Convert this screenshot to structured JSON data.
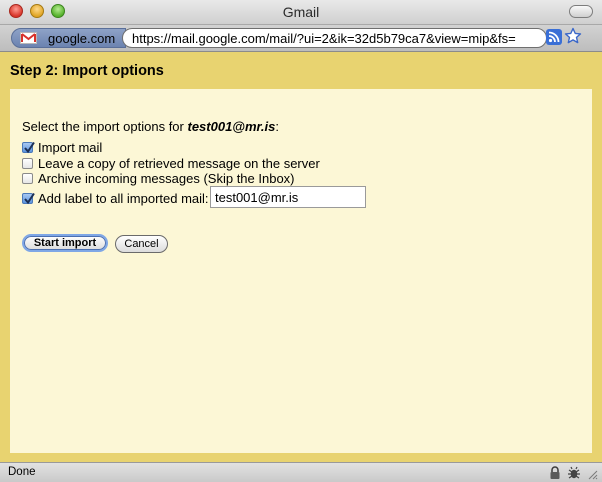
{
  "window": {
    "title": "Gmail"
  },
  "toolbar": {
    "site_label": "google.com",
    "url": "https://mail.google.com/mail/?ui=2&ik=32d5b79ca7&view=mip&fs="
  },
  "page": {
    "step_title": "Step 2: Import options",
    "intro_prefix": "Select the import options for ",
    "account": "test001@mr.is",
    "intro_suffix": ":",
    "options": [
      {
        "label": "Import mail",
        "checked": true
      },
      {
        "label": "Leave a copy of retrieved message on the server",
        "checked": false
      },
      {
        "label": "Archive incoming messages (Skip the Inbox)",
        "checked": false
      },
      {
        "label": "Add label to all imported mail:",
        "checked": true
      }
    ],
    "label_value": "test001@mr.is",
    "start_button": "Start import",
    "cancel_button": "Cancel"
  },
  "status": {
    "text": "Done"
  },
  "colors": {
    "header_band": "#e8d370",
    "panel_bg": "#fcf7d6"
  }
}
